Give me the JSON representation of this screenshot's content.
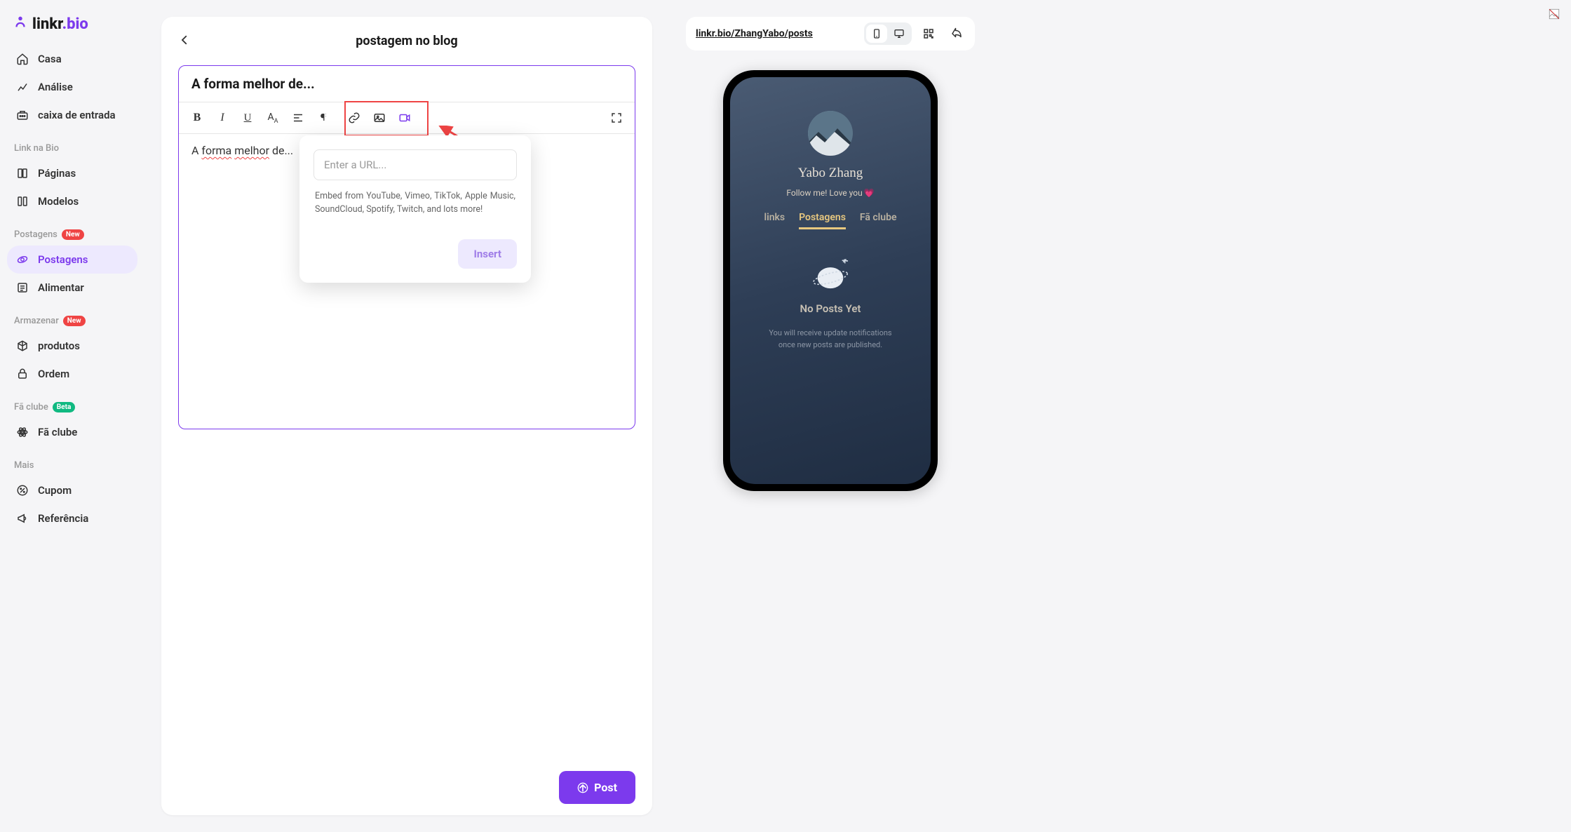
{
  "brand": {
    "part1": "linkr",
    "part2": ".bio"
  },
  "nav": {
    "top": [
      {
        "label": "Casa",
        "icon": "home"
      },
      {
        "label": "Análise",
        "icon": "chart"
      },
      {
        "label": "caixa de entrada",
        "icon": "inbox"
      }
    ],
    "sections": [
      {
        "title": "Link na Bio",
        "badge": null,
        "items": [
          {
            "label": "Páginas",
            "icon": "pages"
          },
          {
            "label": "Modelos",
            "icon": "templates"
          }
        ]
      },
      {
        "title": "Postagens",
        "badge": "New",
        "badgeClass": "new",
        "items": [
          {
            "label": "Postagens",
            "icon": "globe",
            "active": true
          },
          {
            "label": "Alimentar",
            "icon": "feed"
          }
        ]
      },
      {
        "title": "Armazenar",
        "badge": "New",
        "badgeClass": "new",
        "items": [
          {
            "label": "produtos",
            "icon": "cube"
          },
          {
            "label": "Ordem",
            "icon": "lock"
          }
        ]
      },
      {
        "title": "Fã clube",
        "badge": "Beta",
        "badgeClass": "beta",
        "items": [
          {
            "label": "Fã clube",
            "icon": "atom"
          }
        ]
      },
      {
        "title": "Mais",
        "badge": null,
        "items": [
          {
            "label": "Cupom",
            "icon": "percent"
          },
          {
            "label": "Referência",
            "icon": "megaphone"
          }
        ]
      }
    ]
  },
  "editor": {
    "page_title": "postagem no blog",
    "title_value": "A forma melhor de...",
    "content_prefix": "A ",
    "content_w1": "forma",
    "content_w2": "melhor",
    "content_suffix": " de..."
  },
  "popover": {
    "placeholder": "Enter a URL...",
    "hint": "Embed from YouTube, Vimeo, TikTok, Apple Music, SoundCloud, Spotify, Twitch, and lots more!",
    "button": "Insert"
  },
  "post_button": "Post",
  "preview": {
    "url": "linkr.bio/ZhangYabo/posts",
    "name": "Yabo Zhang",
    "bio": "Follow me! Love you",
    "heart": "💗",
    "tabs": [
      "links",
      "Postagens",
      "Fã clube"
    ],
    "active_tab": 1,
    "empty_title": "No Posts Yet",
    "empty_sub": "You will receive update notifications once new posts are published."
  }
}
